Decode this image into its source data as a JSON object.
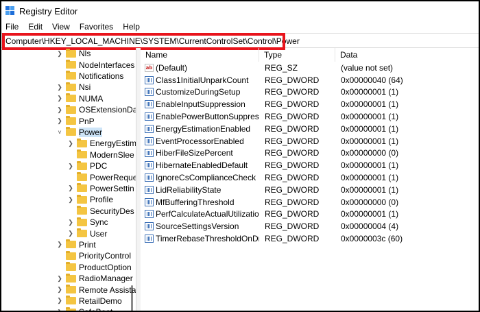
{
  "window": {
    "title": "Registry Editor"
  },
  "menu": [
    "File",
    "Edit",
    "View",
    "Favorites",
    "Help"
  ],
  "address": "Computer\\HKEY_LOCAL_MACHINE\\SYSTEM\\CurrentControlSet\\Control\\Power",
  "tree": [
    {
      "label": "Nls",
      "level": 0,
      "chevron": "right"
    },
    {
      "label": "NodeInterfaces",
      "level": 0,
      "chevron": "none"
    },
    {
      "label": "Notifications",
      "level": 0,
      "chevron": "none"
    },
    {
      "label": "Nsi",
      "level": 0,
      "chevron": "right"
    },
    {
      "label": "NUMA",
      "level": 0,
      "chevron": "right"
    },
    {
      "label": "OSExtensionDa",
      "level": 0,
      "chevron": "right"
    },
    {
      "label": "PnP",
      "level": 0,
      "chevron": "right"
    },
    {
      "label": "Power",
      "level": 0,
      "chevron": "down",
      "selected": true
    },
    {
      "label": "EnergyEstim",
      "level": 1,
      "chevron": "right"
    },
    {
      "label": "ModernSlee",
      "level": 1,
      "chevron": "none"
    },
    {
      "label": "PDC",
      "level": 1,
      "chevron": "right"
    },
    {
      "label": "PowerReque",
      "level": 1,
      "chevron": "none"
    },
    {
      "label": "PowerSettin",
      "level": 1,
      "chevron": "right"
    },
    {
      "label": "Profile",
      "level": 1,
      "chevron": "right"
    },
    {
      "label": "SecurityDes",
      "level": 1,
      "chevron": "none"
    },
    {
      "label": "Sync",
      "level": 1,
      "chevron": "right"
    },
    {
      "label": "User",
      "level": 1,
      "chevron": "right"
    },
    {
      "label": "Print",
      "level": 0,
      "chevron": "right"
    },
    {
      "label": "PriorityControl",
      "level": 0,
      "chevron": "none"
    },
    {
      "label": "ProductOption",
      "level": 0,
      "chevron": "none"
    },
    {
      "label": "RadioManager",
      "level": 0,
      "chevron": "right"
    },
    {
      "label": "Remote Assista",
      "level": 0,
      "chevron": "right"
    },
    {
      "label": "RetailDemo",
      "level": 0,
      "chevron": "right"
    },
    {
      "label": "SafeBoot",
      "level": 0,
      "chevron": "right"
    }
  ],
  "columns": {
    "name": "Name",
    "type": "Type",
    "data": "Data"
  },
  "values": [
    {
      "name": "(Default)",
      "type": "REG_SZ",
      "data": "(value not set)",
      "icon": "string-value-icon"
    },
    {
      "name": "Class1InitialUnparkCount",
      "type": "REG_DWORD",
      "data": "0x00000040 (64)",
      "icon": "dword-value-icon"
    },
    {
      "name": "CustomizeDuringSetup",
      "type": "REG_DWORD",
      "data": "0x00000001 (1)",
      "icon": "dword-value-icon"
    },
    {
      "name": "EnableInputSuppression",
      "type": "REG_DWORD",
      "data": "0x00000001 (1)",
      "icon": "dword-value-icon"
    },
    {
      "name": "EnablePowerButtonSuppressi...",
      "type": "REG_DWORD",
      "data": "0x00000001 (1)",
      "icon": "dword-value-icon"
    },
    {
      "name": "EnergyEstimationEnabled",
      "type": "REG_DWORD",
      "data": "0x00000001 (1)",
      "icon": "dword-value-icon"
    },
    {
      "name": "EventProcessorEnabled",
      "type": "REG_DWORD",
      "data": "0x00000001 (1)",
      "icon": "dword-value-icon"
    },
    {
      "name": "HiberFileSizePercent",
      "type": "REG_DWORD",
      "data": "0x00000000 (0)",
      "icon": "dword-value-icon"
    },
    {
      "name": "HibernateEnabledDefault",
      "type": "REG_DWORD",
      "data": "0x00000001 (1)",
      "icon": "dword-value-icon"
    },
    {
      "name": "IgnoreCsComplianceCheck",
      "type": "REG_DWORD",
      "data": "0x00000001 (1)",
      "icon": "dword-value-icon"
    },
    {
      "name": "LidReliabilityState",
      "type": "REG_DWORD",
      "data": "0x00000001 (1)",
      "icon": "dword-value-icon"
    },
    {
      "name": "MfBufferingThreshold",
      "type": "REG_DWORD",
      "data": "0x00000000 (0)",
      "icon": "dword-value-icon"
    },
    {
      "name": "PerfCalculateActualUtilization",
      "type": "REG_DWORD",
      "data": "0x00000001 (1)",
      "icon": "dword-value-icon"
    },
    {
      "name": "SourceSettingsVersion",
      "type": "REG_DWORD",
      "data": "0x00000004 (4)",
      "icon": "dword-value-icon"
    },
    {
      "name": "TimerRebaseThresholdOnDri...",
      "type": "REG_DWORD",
      "data": "0x0000003c (60)",
      "icon": "dword-value-icon"
    }
  ],
  "colors": {
    "highlight": "#e8141c",
    "folder": "#f4c542",
    "selection": "#cde4f7"
  }
}
